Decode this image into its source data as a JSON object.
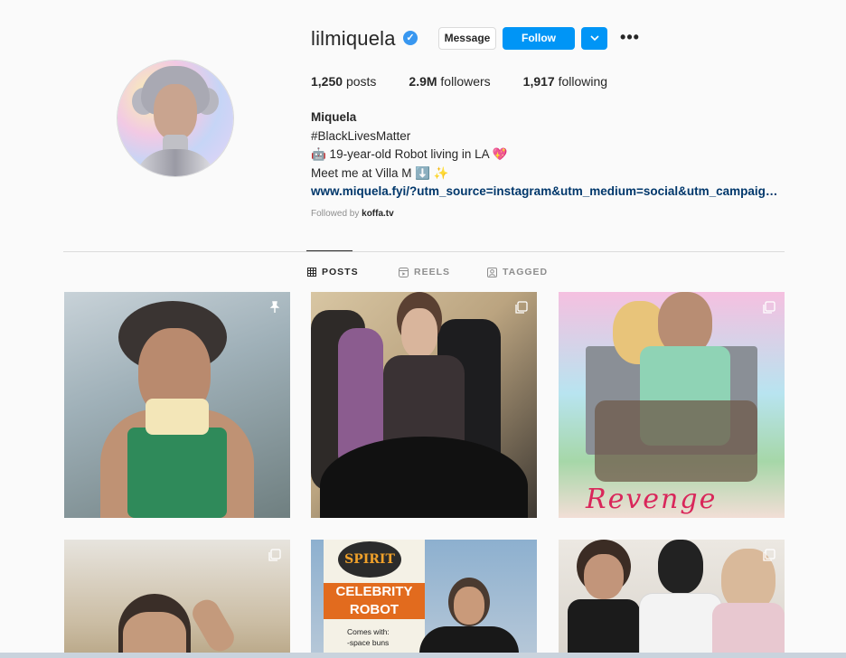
{
  "profile": {
    "username": "lilmiquela",
    "verified_mark": "✓",
    "buttons": {
      "message": "Message",
      "follow": "Follow",
      "more": "•••"
    },
    "stats": [
      {
        "num": "1,250",
        "label": "posts"
      },
      {
        "num": "2.9M",
        "label": "followers"
      },
      {
        "num": "1,917",
        "label": "following"
      }
    ],
    "bio": {
      "name": "Miquela",
      "line1": "#BlackLivesMatter",
      "line2": "🤖 19-year-old Robot living in LA 💖",
      "line3": "Meet me at Villa M ⬇️ ✨",
      "link": "www.miquela.fyi/?utm_source=instagram&utm_medium=social&utm_campaign=b..."
    },
    "followed_by_prefix": "Followed by ",
    "followed_by_user": "koffa.tv"
  },
  "tabs": [
    {
      "label": "POSTS",
      "icon": "grid-icon",
      "active": true
    },
    {
      "label": "REELS",
      "icon": "reels-icon",
      "active": false
    },
    {
      "label": "TAGGED",
      "icon": "tagged-icon",
      "active": false
    }
  ],
  "posts": {
    "tile5_text": [
      "SPIRIT",
      "CELEBRITY",
      "ROBOT",
      "Comes with:",
      "-space buns"
    ],
    "tile3_text": "Revenge"
  },
  "colors": {
    "accent": "#0095f6",
    "verified": "#3897f0",
    "link": "#00376b",
    "muted": "#8e8e8e"
  }
}
